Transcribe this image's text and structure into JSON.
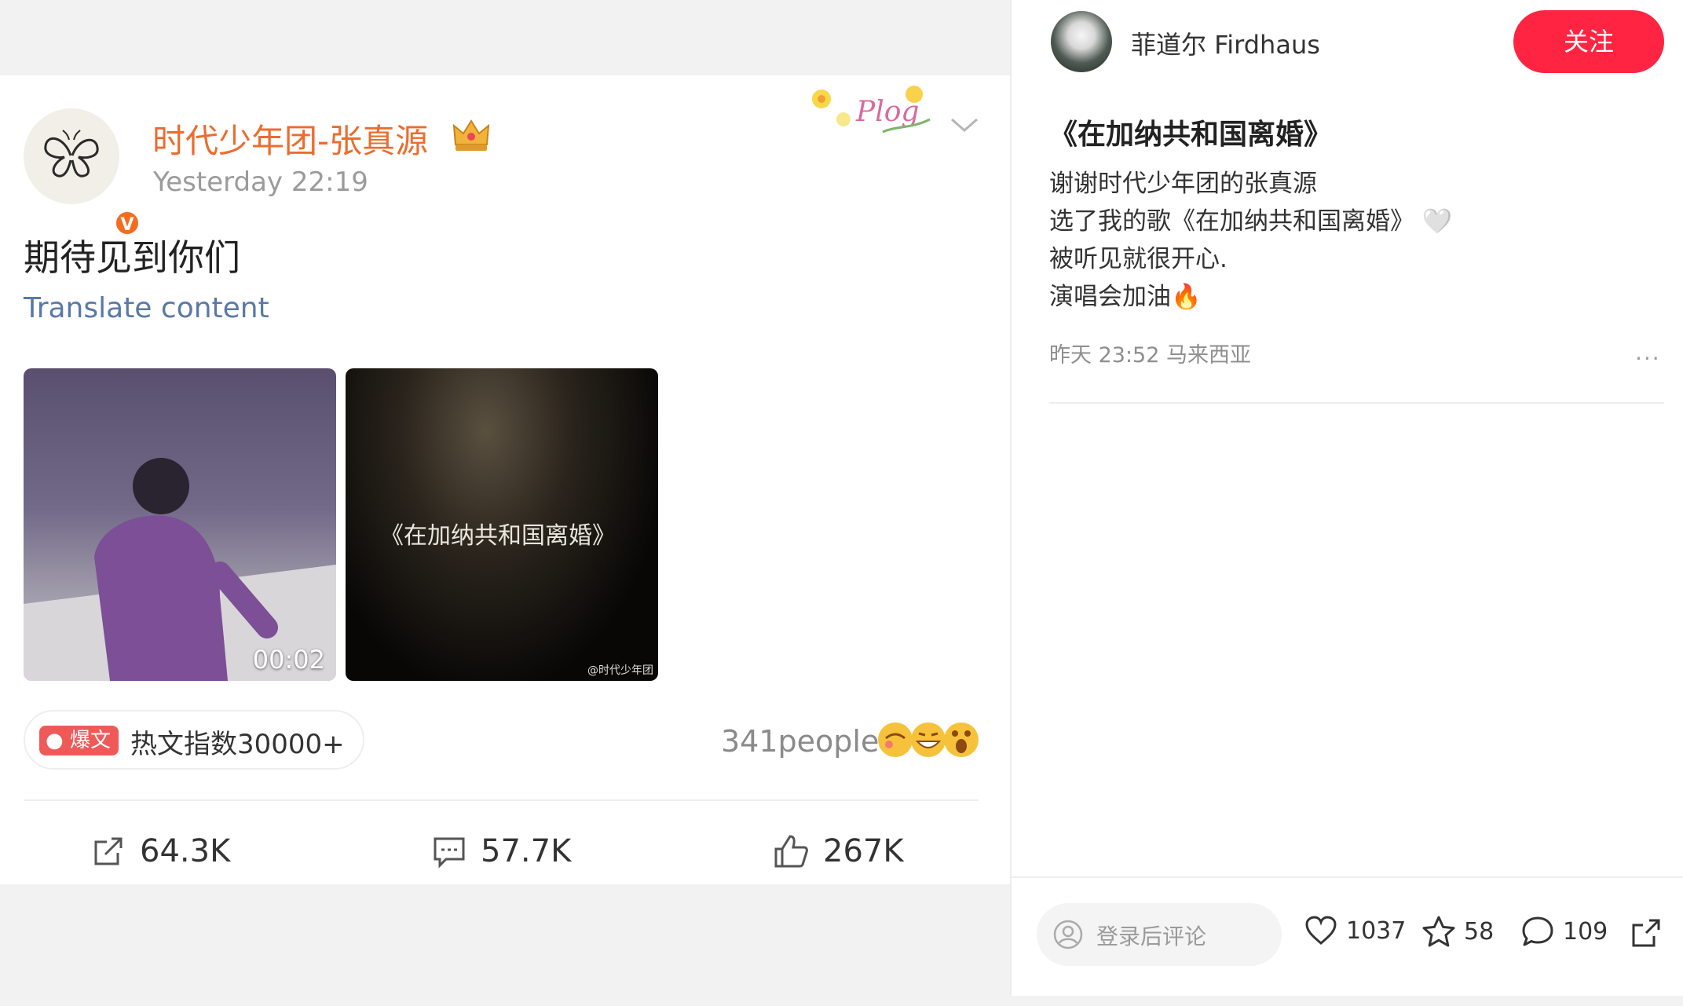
{
  "weibo": {
    "author": "时代少年团-张真源",
    "verified_mark": "V",
    "time": "Yesterday 22:19",
    "text": "期待见到你们",
    "translate_label": "Translate content",
    "media": {
      "video_duration": "00:02",
      "video_title": "《在加纳共和国离婚》",
      "watermark": "@时代少年团"
    },
    "sticker_text": "Plog",
    "hot": {
      "badge": "爆文",
      "label": "热文指数30000+"
    },
    "reactions_label": "341people",
    "actions": {
      "repost": "64.3K",
      "comments": "57.7K",
      "likes": "267K"
    }
  },
  "note": {
    "username": "菲道尔 Firdhaus",
    "follow_label": "关注",
    "title": "《在加纳共和国离婚》",
    "body": [
      "谢谢时代少年团的张真源",
      "选了我的歌《在加纳共和国离婚》 🤍",
      "被听见就很开心.",
      "演唱会加油🔥"
    ],
    "meta": "昨天 23:52 马来西亚",
    "more": "···",
    "comment_placeholder": "登录后评论",
    "stats": {
      "likes": "1037",
      "collects": "58",
      "comments": "109"
    }
  },
  "colors": {
    "weibo_name": "#ec6c2e",
    "follow_bg": "#ff2442",
    "translate_link": "#5a79a6",
    "hot_badge": "#ef5a58"
  }
}
